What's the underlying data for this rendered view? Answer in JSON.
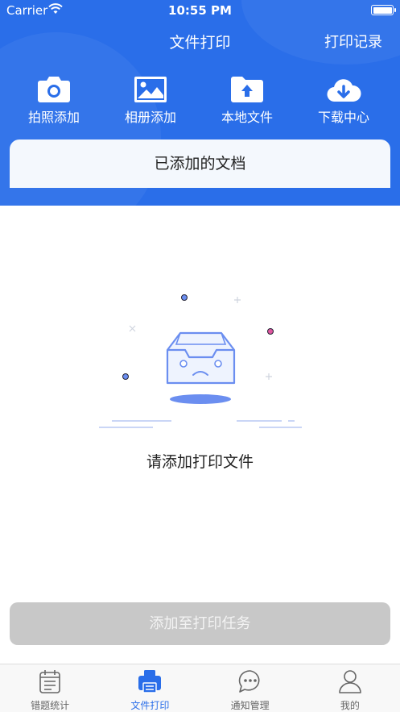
{
  "status_bar": {
    "carrier": "Carrier",
    "time": "10:55 PM"
  },
  "nav": {
    "title": "文件打印",
    "right_action": "打印记录"
  },
  "actions": [
    {
      "label": "拍照添加",
      "icon": "camera-icon"
    },
    {
      "label": "相册添加",
      "icon": "photo-album-icon"
    },
    {
      "label": "本地文件",
      "icon": "folder-upload-icon"
    },
    {
      "label": "下载中心",
      "icon": "cloud-download-icon"
    }
  ],
  "document_section": {
    "title": "已添加的文档"
  },
  "empty_state": {
    "message": "请添加打印文件",
    "illustration": "empty-inbox-illustration"
  },
  "submit_button": {
    "label": "添加至打印任务",
    "enabled": false
  },
  "tabbar": {
    "items": [
      {
        "label": "错题统计",
        "icon": "notebook-icon",
        "active": false
      },
      {
        "label": "文件打印",
        "icon": "printer-icon",
        "active": true
      },
      {
        "label": "通知管理",
        "icon": "chat-bubble-icon",
        "active": false
      },
      {
        "label": "我的",
        "icon": "person-icon",
        "active": false
      }
    ]
  },
  "colors": {
    "brand": "#2a6ee9",
    "disabled_button": "#c8c8c8",
    "accent_pink": "#e0569f"
  }
}
